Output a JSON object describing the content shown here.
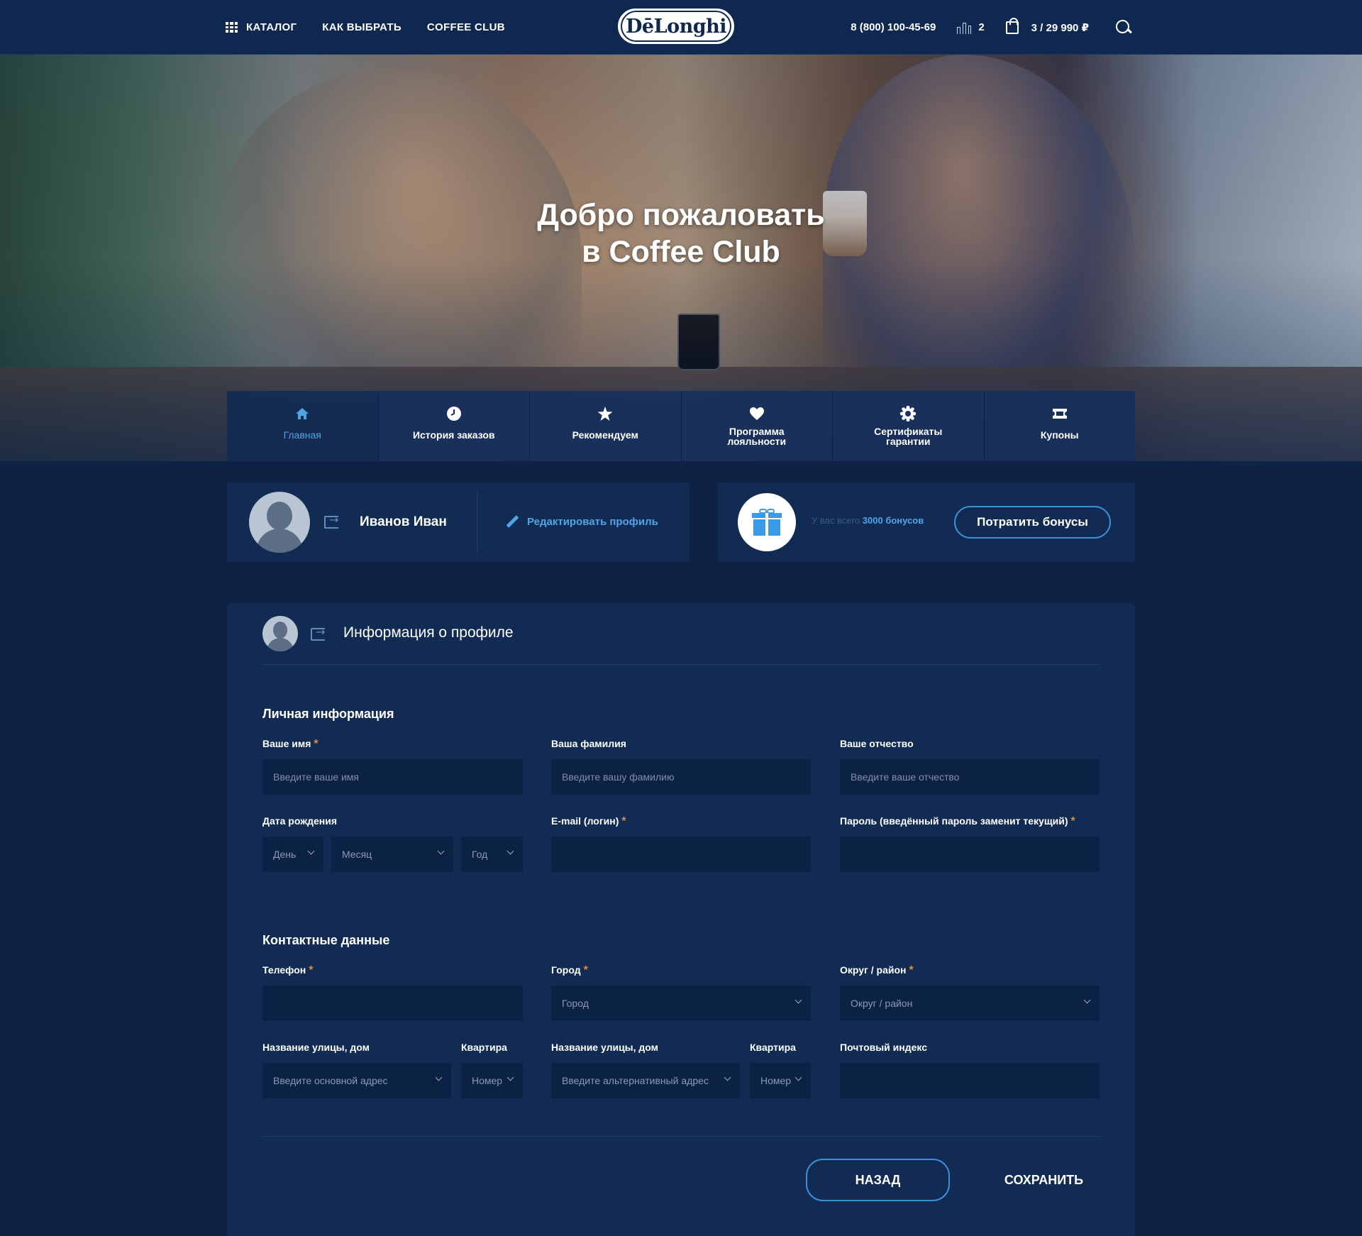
{
  "header": {
    "nav": [
      {
        "label": "КАТАЛОГ",
        "icon": "grid-icon"
      },
      {
        "label": "КАК ВЫБРАТЬ"
      },
      {
        "label": "COFFEE CLUB"
      }
    ],
    "logo": "DēLonghi",
    "phone": "8 (800) 100-45-69",
    "compare_count": "2",
    "cart": "3 / 29 990 ₽"
  },
  "hero": {
    "title_line1": "Добро пожаловать",
    "title_line2": "в Coffee Club"
  },
  "tabs": [
    {
      "label": "Главная",
      "icon": "home-icon",
      "active": true
    },
    {
      "label": "История заказов",
      "icon": "clock-icon"
    },
    {
      "label": "Рекомендуем",
      "icon": "star-icon"
    },
    {
      "label_line1": "Программа",
      "label_line2": "лояльности",
      "icon": "heart-icon"
    },
    {
      "label_line1": "Сертификаты",
      "label_line2": "гарантии",
      "icon": "badge-icon"
    },
    {
      "label": "Купоны",
      "icon": "ticket-icon"
    }
  ],
  "user": {
    "name": "Иванов Иван",
    "edit_label": "Редактировать профиль"
  },
  "bonus": {
    "prefix": "У вас всего",
    "amount": "3000 бонусов",
    "spend_label": "Потратить бонусы"
  },
  "profile_form": {
    "title": "Информация о профиле",
    "personal_title": "Личная информация",
    "first_name": {
      "label": "Ваше имя",
      "required": "*",
      "placeholder": "Введите ваше имя"
    },
    "last_name": {
      "label": "Ваша фамилия",
      "placeholder": "Введите вашу фамилию"
    },
    "middle_name": {
      "label": "Ваше отчество",
      "placeholder": "Введите ваше отчество"
    },
    "birth": {
      "label": "Дата рождения",
      "day": "День",
      "month": "Месяц",
      "year": "Год"
    },
    "email": {
      "label": "E-mail (логин)",
      "required": "*"
    },
    "password": {
      "label": "Пароль (введённый пароль заменит текущий)",
      "required": "*"
    },
    "contacts_title": "Контактные данные",
    "phone": {
      "label": "Телефон",
      "required": "*"
    },
    "city": {
      "label": "Город",
      "required": "*",
      "value": "Город"
    },
    "district": {
      "label": "Округ / район",
      "required": "*",
      "value": "Округ / район"
    },
    "street1": {
      "label": "Название улицы, дом",
      "value": "Введите основной адрес"
    },
    "apt1": {
      "label": "Квартира",
      "value": "Номер"
    },
    "street2": {
      "label": "Название улицы, дом",
      "value": "Введите альтернативный адрес"
    },
    "apt2": {
      "label": "Квартира",
      "value": "Номер"
    },
    "postal": {
      "label": "Почтовый индекс"
    },
    "back_label": "НАЗАД",
    "save_label": "СОХРАНИТЬ"
  },
  "colors": {
    "background": "#0d2245",
    "panel": "#112b53",
    "accent": "#4fa5e8",
    "required": "#e28a3a"
  }
}
